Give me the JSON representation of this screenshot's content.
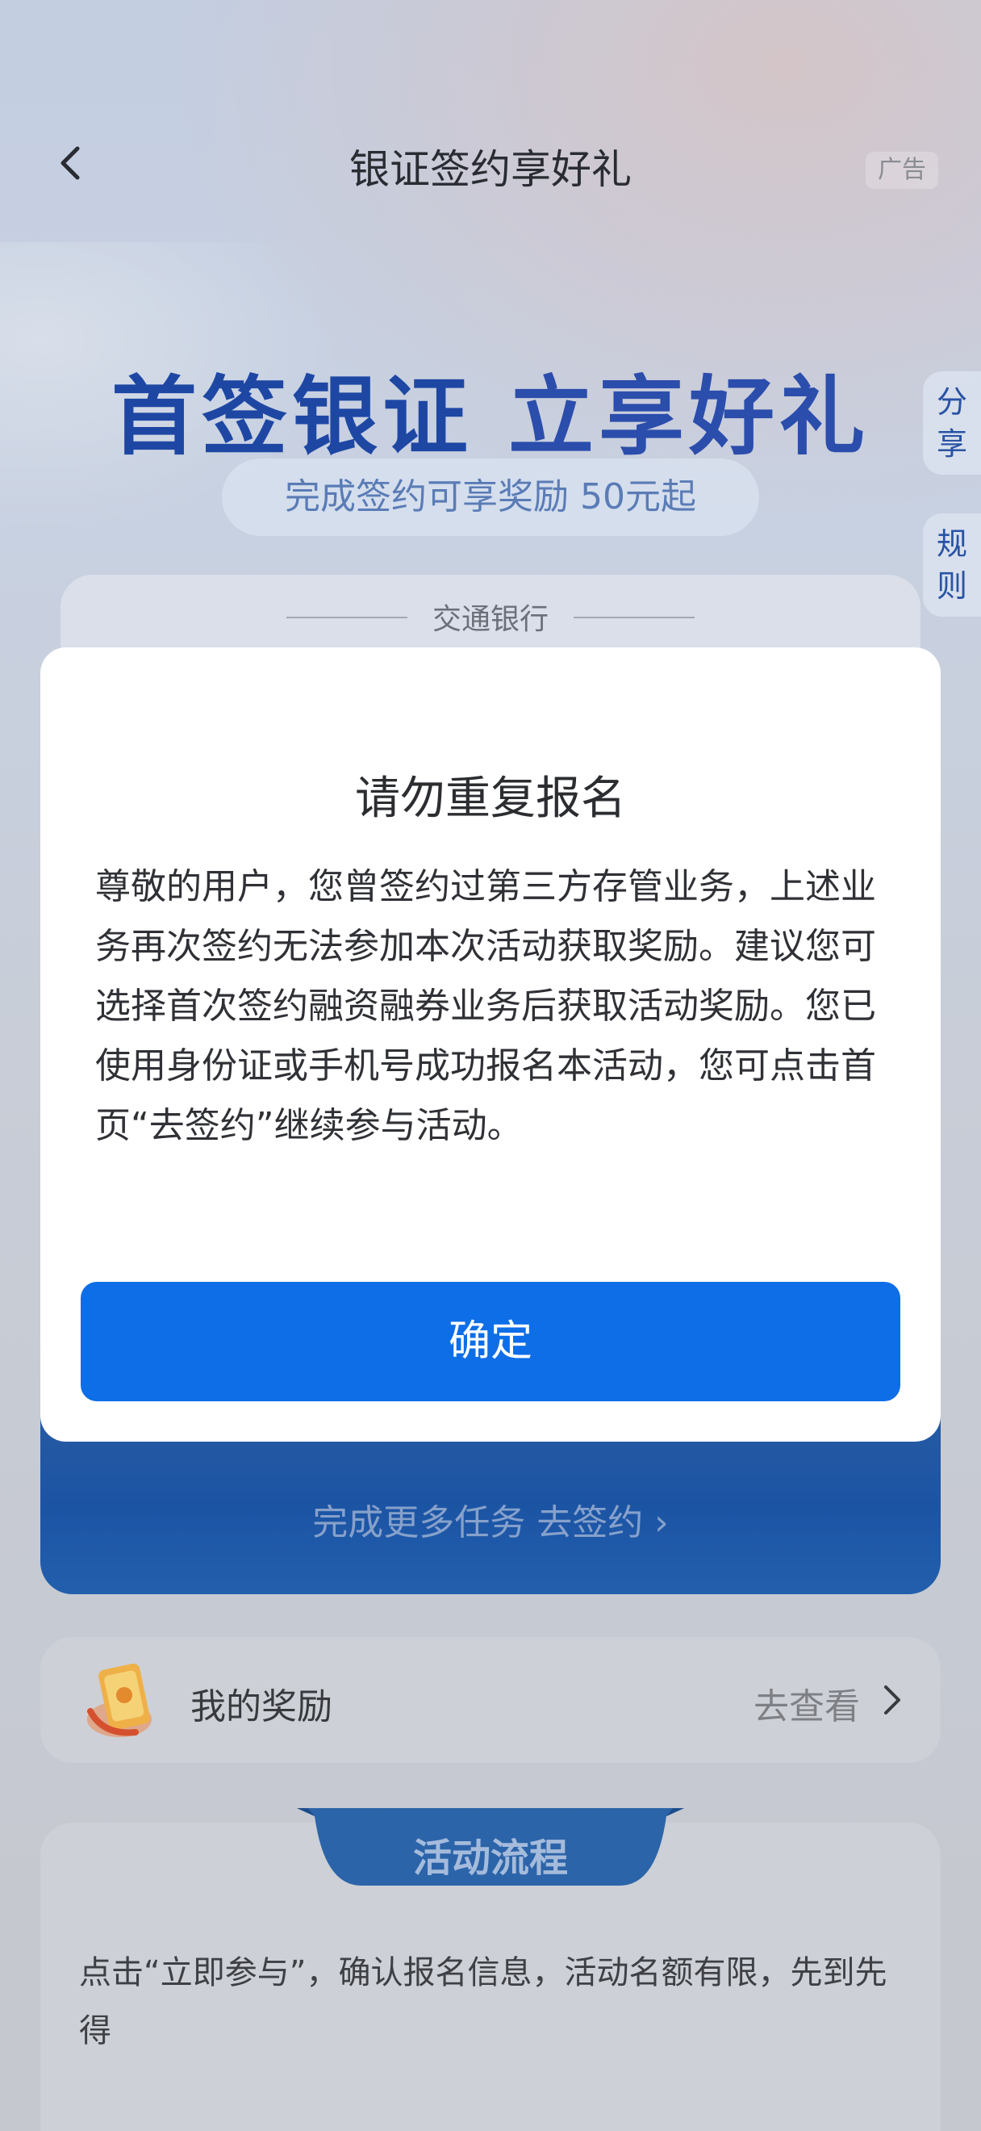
{
  "header": {
    "title": "银证签约享好礼",
    "ad_label": "广告",
    "back_icon": "back-arrow-icon"
  },
  "side_tabs": {
    "share": [
      "分",
      "享"
    ],
    "rules": [
      "规",
      "则"
    ]
  },
  "hero": {
    "title_part1": "首签银证",
    "title_part2": "立享好礼",
    "subtitle": "完成签约可享奖励 50元起"
  },
  "bank_card": {
    "bank_name": "交通银行"
  },
  "tasks": {
    "more_tasks_label": "完成更多任务 去签约 ›"
  },
  "reward": {
    "title": "我的奖励",
    "link_label": "去查看"
  },
  "flow": {
    "tab_label": "活动流程",
    "text": "点击“立即参与”，确认报名信息，活动名额有限，先到先得"
  },
  "dialog": {
    "title": "请勿重复报名",
    "body": "尊敬的用户，您曾签约过第三方存管业务，上述业务再次签约无法参加本次活动获取奖励。建议您可选择首次签约融资融券业务后获取活动奖励。您已使用身份证或手机号成功报名本活动，您可点击首页“去签约”继续参与活动。",
    "confirm_label": "确定"
  },
  "colors": {
    "accent": "#0d6ee8",
    "hero_blue": "#1f49a8",
    "card_blue": "#1d56a8"
  }
}
